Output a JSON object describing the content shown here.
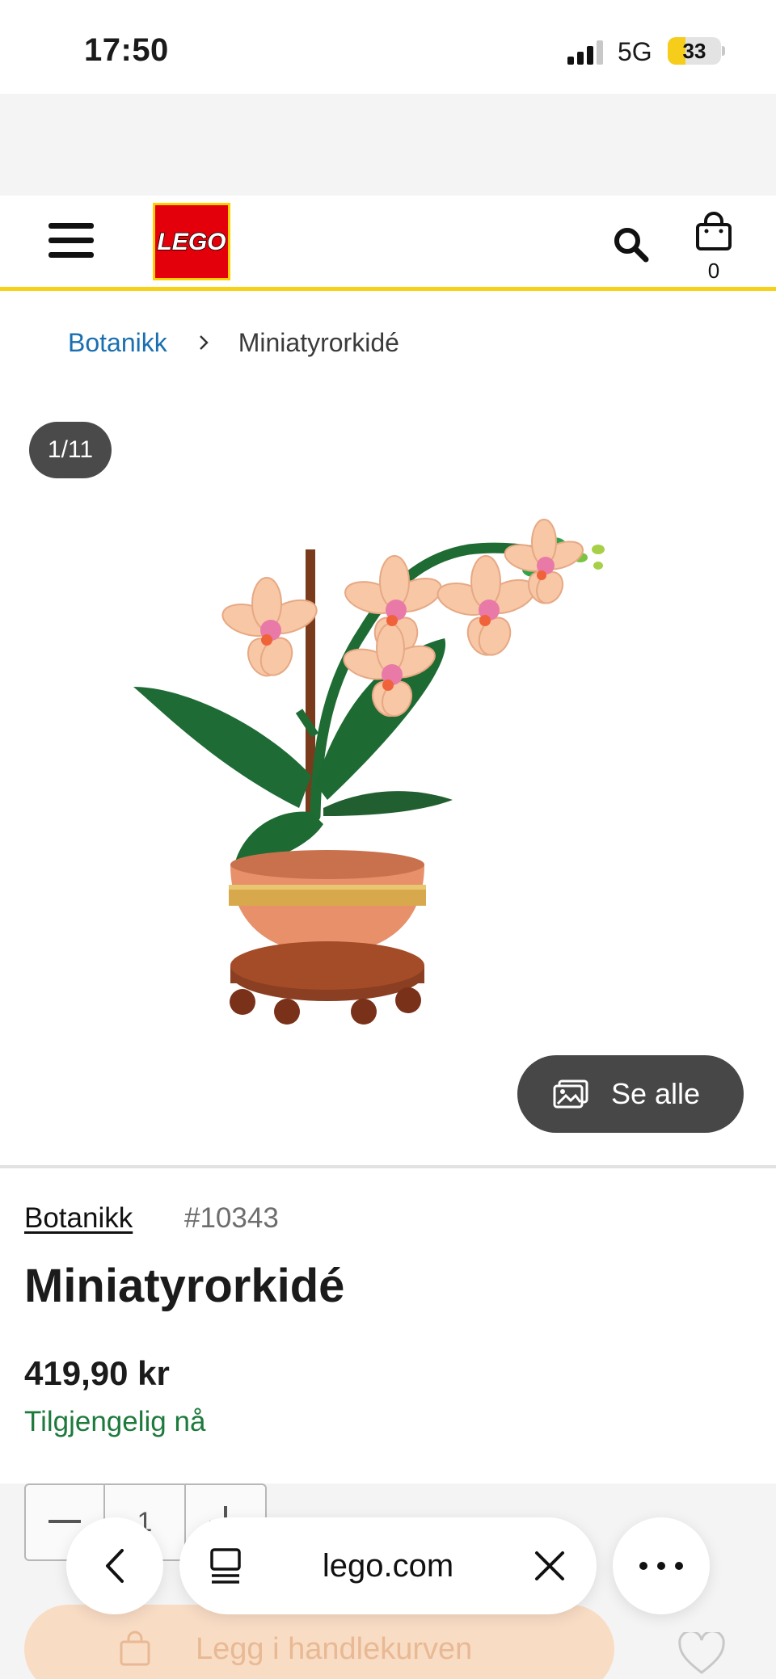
{
  "status_bar": {
    "time": "17:50",
    "network": "5G",
    "battery_level": "33"
  },
  "header": {
    "logo_text": "LEGO",
    "cart_count": "0"
  },
  "breadcrumb": {
    "parent": "Botanikk",
    "current": "Miniatyrorkidé"
  },
  "gallery": {
    "counter": "1/11",
    "see_all_label": "Se alle"
  },
  "product": {
    "theme": "Botanikk",
    "item_number": "#10343",
    "name": "Miniatyrorkidé",
    "price": "419,90 kr",
    "availability": "Tilgjengelig nå",
    "quantity": "1",
    "add_to_bag_label": "Legg i handlekurven"
  },
  "browser": {
    "url": "lego.com"
  },
  "colors": {
    "brand_red": "#e3000b",
    "brand_yellow": "#f7d117",
    "link_blue": "#1a6fb0",
    "availability_green": "#1d7a3c",
    "pill_dark": "#474747"
  },
  "icons": [
    "hamburger-menu-icon",
    "search-icon",
    "shopping-bag-icon",
    "chevron-right-icon",
    "gallery-image-icon",
    "tabs-icon",
    "close-icon",
    "more-icon",
    "back-icon",
    "heart-icon"
  ]
}
